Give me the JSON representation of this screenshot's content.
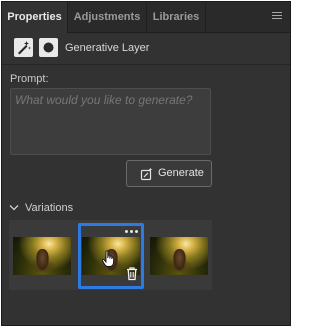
{
  "tabs": [
    {
      "label": "Properties",
      "active": true
    },
    {
      "label": "Adjustments",
      "active": false
    },
    {
      "label": "Libraries",
      "active": false
    }
  ],
  "layer": {
    "title": "Generative Layer",
    "icons": [
      "generative-layer-icon",
      "layer-mask-icon"
    ]
  },
  "prompt": {
    "label": "Prompt:",
    "value": "",
    "placeholder": "What would you like to generate?"
  },
  "generate_button": {
    "label": "Generate",
    "icon": "generate-sparkle-icon"
  },
  "variations": {
    "label": "Variations",
    "expanded": true,
    "selected_index": 1,
    "count": 3,
    "icons": [
      "more-options-icon",
      "delete-icon",
      "hand-cursor-icon"
    ]
  },
  "colors": {
    "panel_bg": "#323232",
    "tab_bar_bg": "#2a2a2a",
    "selection_accent": "#2c7be5",
    "text": "#d8d8d8",
    "placeholder": "#767676"
  }
}
